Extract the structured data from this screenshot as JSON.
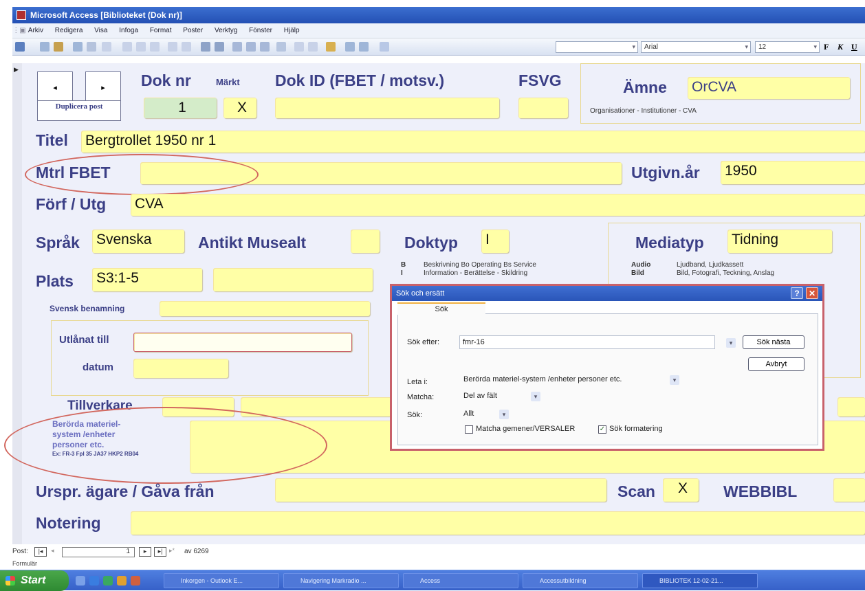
{
  "window": {
    "title": "Microsoft Access   [Biblioteket (Dok nr)]"
  },
  "menu": [
    "Arkiv",
    "Redigera",
    "Visa",
    "Infoga",
    "Format",
    "Poster",
    "Verktyg",
    "Fönster",
    "Hjälp"
  ],
  "toolbar": {
    "font_name": "Arial",
    "font_size": "12",
    "bold": "F",
    "italic": "K",
    "underline": "U"
  },
  "form": {
    "duplicate_label": "Duplicera post",
    "dok_nr_label": "Dok nr",
    "dok_nr_value": "1",
    "markt_label": "Märkt",
    "markt_value": "X",
    "dok_id_label": "Dok ID (FBET / motsv.)",
    "fsvg_label": "FSVG",
    "amne_label": "Ämne",
    "amne_value": "OrCVA",
    "amne_desc": "Organisationer - Institutioner - CVA",
    "titel_label": "Titel",
    "titel_value": "Bergtrollet 1950 nr 1",
    "mtrl_label": "Mtrl FBET",
    "utgivn_label": "Utgivn.år",
    "utgivn_value": "1950",
    "forf_label": "Förf / Utg",
    "forf_value": "CVA",
    "sprak_label": "Språk",
    "sprak_value": "Svenska",
    "antikt_label": "Antikt Musealt",
    "doktyp_label": "Doktyp",
    "doktyp_value": "I",
    "mediatyp_label": "Mediatyp",
    "mediatyp_value": "Tidning",
    "doktyp_legend": [
      {
        "code": "B",
        "text": "Beskrivning  Bo Operating  Bs Service"
      },
      {
        "code": "I",
        "text": "Information - Berättelse - Skildring"
      }
    ],
    "media_legend": [
      {
        "code": "Audio",
        "text": "Ljudband, Ljudkassett"
      },
      {
        "code": "Bild",
        "text": "Bild, Fotografi, Teckning, Anslag"
      }
    ],
    "plats_label": "Plats",
    "plats_value": "S3:1-5",
    "svensk_label": "Svensk benamning",
    "utlanat_label": "Utlånat till",
    "datum_label": "datum",
    "tillverkare_label": "Tillverkare",
    "berorda_label_1": "Berörda materiel-",
    "berorda_label_2": "system /enheter",
    "berorda_label_3": "personer etc.",
    "berorda_example": "Ex: FR-3 Fpl 35 JA37 HKP2 RB04",
    "urspr_label": "Urspr. ägare / Gåva från",
    "scan_label": "Scan",
    "scan_value": "X",
    "webbibl_label": "WEBBIBL",
    "notering_label": "Notering"
  },
  "dialog": {
    "title": "Sök och ersätt",
    "tab_label": "Sök",
    "sok_efter_label": "Sök efter:",
    "sok_efter_value": "fmr-16",
    "next_button": "Sök nästa",
    "cancel_button": "Avbryt",
    "leta_label": "Leta i:",
    "leta_value": "Berörda materiel-system /enheter personer etc.",
    "matcha_label": "Matcha:",
    "matcha_value": "Del av fält",
    "sok_label": "Sök:",
    "sok_value": "Allt",
    "match_case_label": "Matcha gemener/VERSALER",
    "match_case_checked": false,
    "search_format_label": "Sök formatering",
    "search_format_checked": true
  },
  "record_nav": {
    "label": "Post:",
    "current": "1",
    "of_text": "av 6269"
  },
  "statusbar": {
    "text": "Formulär"
  },
  "taskbar": {
    "start_label": "Start",
    "items": [
      "Inkorgen - Outlook E...",
      "Navigering Markradio ...",
      "Access",
      "Accessutbildning",
      "BIBLIOTEK 12-02-21..."
    ]
  }
}
